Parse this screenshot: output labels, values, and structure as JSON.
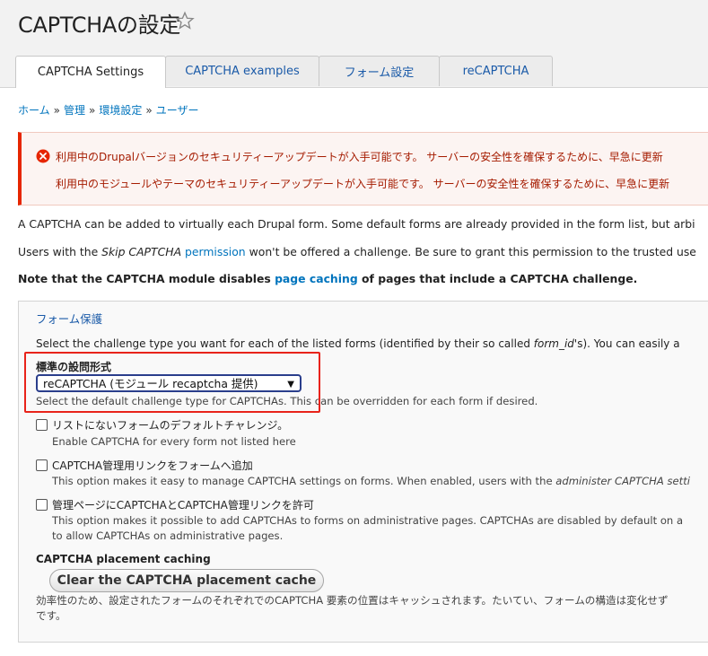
{
  "page": {
    "title": "CAPTCHAの設定",
    "star_icon": "star-outline-icon"
  },
  "tabs": [
    {
      "label": "CAPTCHA Settings",
      "active": true
    },
    {
      "label": "CAPTCHA examples",
      "active": false
    },
    {
      "label": "フォーム設定",
      "active": false
    },
    {
      "label": "reCAPTCHA",
      "active": false
    }
  ],
  "breadcrumb": [
    "ホーム",
    "管理",
    "環境設定",
    "ユーザー"
  ],
  "breadcrumb_separator": "»",
  "alert": {
    "icon": "error-circle-icon",
    "message_1": "利用中のDrupalバージョンのセキュリティーアップデートが入手可能です。 サーバーの安全性を確保するために、早急に更新",
    "message_2": "利用中のモジュールやテーマのセキュリティーアップデートが入手可能です。 サーバーの安全性を確保するために、早急に更新"
  },
  "intro": {
    "line1": "A CAPTCHA can be added to virtually each Drupal form. Some default forms are already provided in the form list, but arbi",
    "line2_a": "Users with the ",
    "line2_em": "Skip CAPTCHA",
    "line2_link": "permission",
    "line2_b": " won't be offered a challenge. Be sure to grant this permission to the trusted use",
    "line3_a": "Note that the CAPTCHA module disables ",
    "line3_link": "page caching",
    "line3_b": " of pages that include a CAPTCHA challenge."
  },
  "form_protection": {
    "legend": "フォーム保護",
    "description_a": "Select the challenge type you want for each of the listed forms (identified by their so called ",
    "description_em": "form_id",
    "description_b": "'s). You can easily a",
    "default_type_label": "標準の設問形式",
    "default_type_value": "reCAPTCHA (モジュール recaptcha 提供)",
    "default_type_caret": "▼",
    "default_type_help": "Select the default challenge type for CAPTCHAs. This can be overridden for each form if desired.",
    "checkboxes": [
      {
        "label": "リストにないフォームのデフォルトチャレンジ。",
        "help": "Enable CAPTCHA for every form not listed here",
        "checked": false
      },
      {
        "label": "CAPTCHA管理用リンクをフォームへ追加",
        "help_a": "This option makes it easy to manage CAPTCHA settings on forms. When enabled, users with the ",
        "help_em": "administer CAPTCHA setti",
        "checked": false
      },
      {
        "label": "管理ページにCAPTCHAとCAPTCHA管理リンクを許可",
        "help_1": "This option makes it possible to add CAPTCHAs to forms on administrative pages. CAPTCHAs are disabled by default on a",
        "help_2": "to allow CAPTCHAs on administrative pages.",
        "checked": false
      }
    ],
    "placement_caching_label": "CAPTCHA placement caching",
    "clear_button_label": "Clear the CAPTCHA placement cache",
    "placement_help_1": "効率性のため、設定されたフォームのそれぞれでのCAPTCHA 要素の位置はキャッシュされます。たいてい、フォームの構造は変化せず",
    "placement_help_2": "です。"
  },
  "colors": {
    "link": "#0074bd",
    "error": "#e62600",
    "highlight": "#e8231a"
  }
}
